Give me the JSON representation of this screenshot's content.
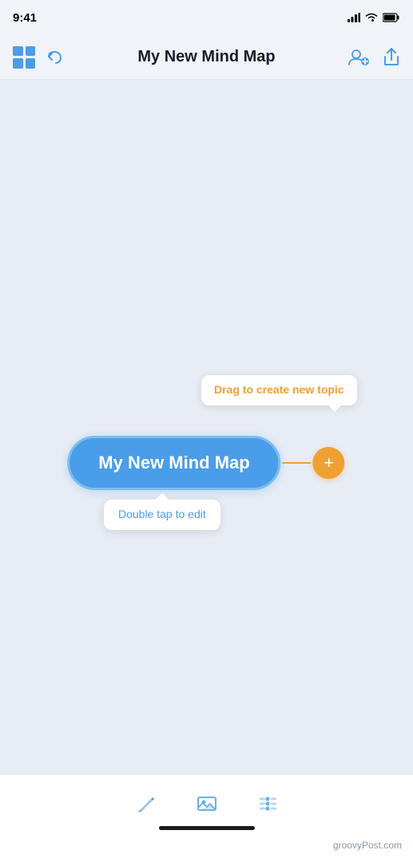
{
  "statusBar": {
    "time": "9:41",
    "icons": [
      "signal",
      "wifi",
      "battery"
    ]
  },
  "navBar": {
    "title": "My New Mind Map",
    "undoLabel": "undo",
    "addCollaboratorLabel": "add-collaborator",
    "shareLabel": "share"
  },
  "canvas": {
    "nodeText": "My New Mind Map",
    "tooltipDrag": "Drag to create new topic",
    "tooltipEdit": "Double tap to edit"
  },
  "toolbar": {
    "icons": [
      "pen-tool",
      "image-tool",
      "menu-tool"
    ]
  },
  "watermark": "groovyPost.com",
  "colors": {
    "accent": "#4a9de8",
    "orange": "#f0a030",
    "background": "#e8edf5",
    "white": "#ffffff"
  }
}
